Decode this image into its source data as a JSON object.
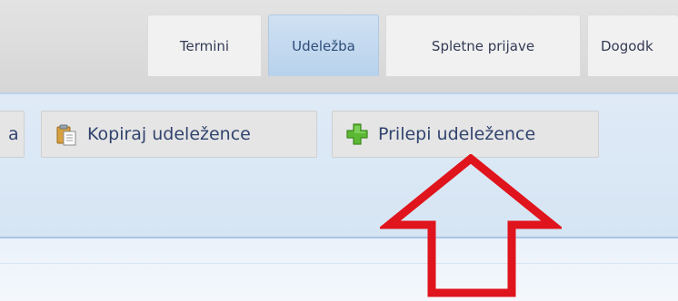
{
  "tabs": [
    {
      "label": "Termini",
      "active": false
    },
    {
      "label": "Udeležba",
      "active": true
    },
    {
      "label": "Spletne prijave",
      "active": false
    },
    {
      "label": "Dogodk",
      "active": false
    }
  ],
  "toolbar": {
    "partial_button_label": "a",
    "copy_button_label": "Kopiraj udeležence",
    "paste_button_label": "Prilepi udeležence",
    "copy_icon": "clipboard-copy-icon",
    "paste_icon": "green-plus-icon"
  },
  "annotation": {
    "arrow_color": "#e0141c",
    "arrow_direction": "up"
  }
}
